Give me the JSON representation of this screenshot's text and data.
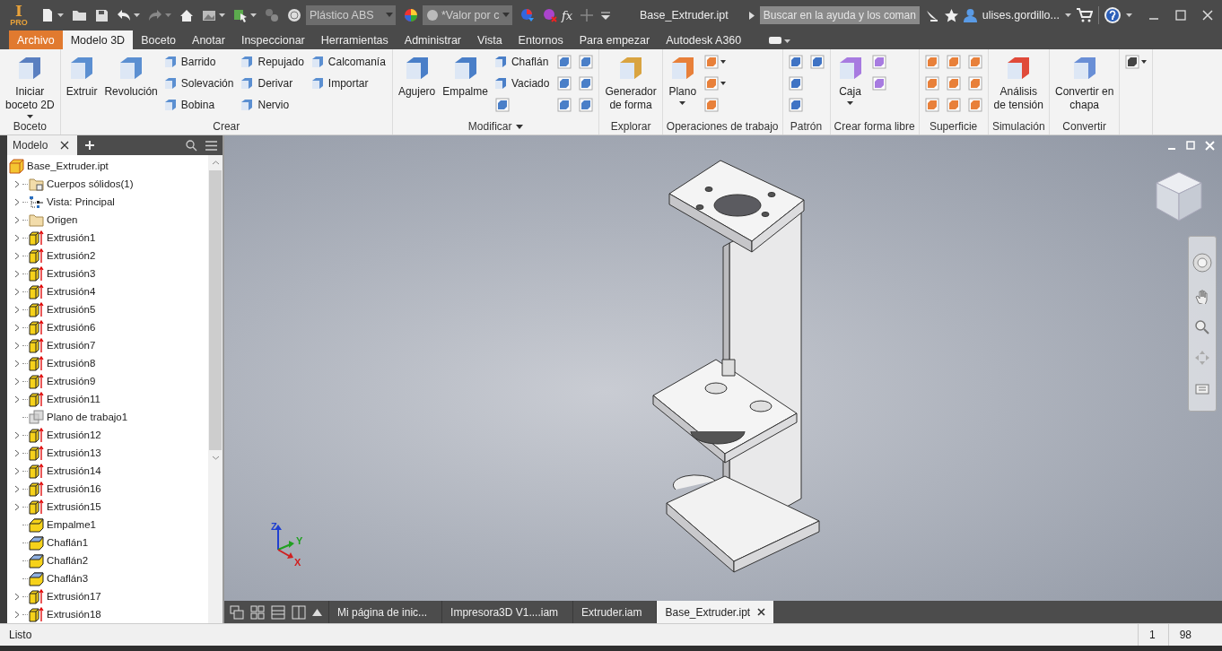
{
  "app_logo": {
    "letter": "I",
    "caption": "PRO"
  },
  "quick_access": {
    "material": "Plástico ABS",
    "appearance": "*Valor por c",
    "formula": "fx"
  },
  "window": {
    "title": "Base_Extruder.ipt"
  },
  "search": {
    "placeholder": "Buscar en la ayuda y los coman"
  },
  "user": {
    "name": "ulises.gordillo..."
  },
  "ribbon_tabs": [
    {
      "label": "Archivo",
      "kind": "app",
      "selected": false
    },
    {
      "label": "Modelo 3D",
      "kind": "tab",
      "selected": true
    },
    {
      "label": "Boceto",
      "kind": "tab",
      "selected": false
    },
    {
      "label": "Anotar",
      "kind": "tab",
      "selected": false
    },
    {
      "label": "Inspeccionar",
      "kind": "tab",
      "selected": false
    },
    {
      "label": "Herramientas",
      "kind": "tab",
      "selected": false
    },
    {
      "label": "Administrar",
      "kind": "tab",
      "selected": false
    },
    {
      "label": "Vista",
      "kind": "tab",
      "selected": false
    },
    {
      "label": "Entornos",
      "kind": "tab",
      "selected": false
    },
    {
      "label": "Para empezar",
      "kind": "tab",
      "selected": false
    },
    {
      "label": "Autodesk A360",
      "kind": "tab",
      "selected": false
    }
  ],
  "ribbon_panels": [
    {
      "title": "Boceto",
      "columns": [
        {
          "tools": [
            {
              "kind": "large",
              "label": "Iniciar\nboceto 2D",
              "dropdown": true
            }
          ]
        }
      ]
    },
    {
      "title": "Crear",
      "columns": [
        {
          "tools": [
            {
              "kind": "large",
              "label": "Extruir"
            }
          ]
        },
        {
          "tools": [
            {
              "kind": "large",
              "label": "Revolución"
            }
          ]
        },
        {
          "tools": [
            {
              "kind": "small",
              "label": "Barrido"
            },
            {
              "kind": "small",
              "label": "Solevación"
            },
            {
              "kind": "small",
              "label": "Bobina"
            }
          ]
        },
        {
          "tools": [
            {
              "kind": "small",
              "label": "Repujado"
            },
            {
              "kind": "small",
              "label": "Derivar"
            },
            {
              "kind": "small",
              "label": "Nervio"
            }
          ]
        },
        {
          "tools": [
            {
              "kind": "small",
              "label": "Calcomanía"
            },
            {
              "kind": "small",
              "label": "Importar"
            }
          ]
        }
      ]
    },
    {
      "title": "Modificar",
      "menu": true,
      "columns": [
        {
          "tools": [
            {
              "kind": "large",
              "label": "Agujero"
            }
          ]
        },
        {
          "tools": [
            {
              "kind": "large",
              "label": "Empalme"
            }
          ]
        },
        {
          "tools": [
            {
              "kind": "small",
              "label": "Chaflán"
            },
            {
              "kind": "small",
              "label": "Vaciado"
            },
            {
              "kind": "icon"
            }
          ]
        },
        {
          "tools": [
            {
              "kind": "icon"
            },
            {
              "kind": "icon"
            },
            {
              "kind": "icon"
            }
          ]
        },
        {
          "tools": [
            {
              "kind": "icon"
            },
            {
              "kind": "icon"
            },
            {
              "kind": "icon"
            }
          ]
        }
      ]
    },
    {
      "title": "Explorar",
      "columns": [
        {
          "tools": [
            {
              "kind": "large",
              "label": "Generador\nde forma"
            }
          ]
        }
      ]
    },
    {
      "title": "Operaciones de trabajo",
      "columns": [
        {
          "tools": [
            {
              "kind": "large",
              "label": "Plano",
              "dropdown": true
            }
          ]
        },
        {
          "tools": [
            {
              "kind": "icon",
              "dropdown": true
            },
            {
              "kind": "icon",
              "dropdown": true
            },
            {
              "kind": "icon"
            }
          ]
        }
      ]
    },
    {
      "title": "Patrón",
      "columns": [
        {
          "tools": [
            {
              "kind": "icon"
            },
            {
              "kind": "icon"
            },
            {
              "kind": "icon"
            }
          ]
        },
        {
          "tools": [
            {
              "kind": "icon"
            }
          ]
        }
      ]
    },
    {
      "title": "Crear forma libre",
      "columns": [
        {
          "tools": [
            {
              "kind": "large",
              "label": "Caja",
              "dropdown": true
            }
          ]
        },
        {
          "tools": [
            {
              "kind": "icon"
            },
            {
              "kind": "icon"
            }
          ]
        }
      ]
    },
    {
      "title": "Superficie",
      "columns": [
        {
          "tools": [
            {
              "kind": "icon"
            },
            {
              "kind": "icon"
            },
            {
              "kind": "icon"
            }
          ]
        },
        {
          "tools": [
            {
              "kind": "icon"
            },
            {
              "kind": "icon"
            },
            {
              "kind": "icon"
            }
          ]
        },
        {
          "tools": [
            {
              "kind": "icon"
            },
            {
              "kind": "icon"
            },
            {
              "kind": "icon"
            }
          ]
        }
      ]
    },
    {
      "title": "Simulación",
      "columns": [
        {
          "tools": [
            {
              "kind": "large",
              "label": "Análisis\nde tensión"
            }
          ]
        }
      ]
    },
    {
      "title": "Convertir",
      "columns": [
        {
          "tools": [
            {
              "kind": "large",
              "label": "Convertir en\nchapa"
            }
          ]
        }
      ]
    },
    {
      "columns": [
        {
          "tools": [
            {
              "kind": "icon",
              "dropdown": true
            }
          ]
        }
      ]
    }
  ],
  "browser": {
    "tab": "Modelo",
    "root": {
      "label": "Base_Extruder.ipt",
      "children": [
        {
          "label": "Cuerpos sólidos(1)",
          "kind": "solids",
          "collapsible": true
        },
        {
          "label": "Vista: Principal",
          "kind": "view",
          "collapsible": true
        },
        {
          "label": "Origen",
          "kind": "folder",
          "collapsible": true
        },
        {
          "label": "Extrusión1",
          "kind": "extrusion",
          "collapsible": true
        },
        {
          "label": "Extrusión2",
          "kind": "extrusion",
          "collapsible": true
        },
        {
          "label": "Extrusión3",
          "kind": "extrusion",
          "collapsible": true
        },
        {
          "label": "Extrusión4",
          "kind": "extrusion",
          "collapsible": true
        },
        {
          "label": "Extrusión5",
          "kind": "extrusion",
          "collapsible": true
        },
        {
          "label": "Extrusión6",
          "kind": "extrusion",
          "collapsible": true
        },
        {
          "label": "Extrusión7",
          "kind": "extrusion",
          "collapsible": true
        },
        {
          "label": "Extrusión8",
          "kind": "extrusion",
          "collapsible": true
        },
        {
          "label": "Extrusión9",
          "kind": "extrusion",
          "collapsible": true
        },
        {
          "label": "Extrusión11",
          "kind": "extrusion",
          "collapsible": true
        },
        {
          "label": "Plano de trabajo1",
          "kind": "plane",
          "collapsible": false
        },
        {
          "label": "Extrusión12",
          "kind": "extrusion",
          "collapsible": true
        },
        {
          "label": "Extrusión13",
          "kind": "extrusion",
          "collapsible": true
        },
        {
          "label": "Extrusión14",
          "kind": "extrusion",
          "collapsible": true
        },
        {
          "label": "Extrusión16",
          "kind": "extrusion",
          "collapsible": true
        },
        {
          "label": "Extrusión15",
          "kind": "extrusion",
          "collapsible": true
        },
        {
          "label": "Empalme1",
          "kind": "fillet",
          "collapsible": false
        },
        {
          "label": "Chaflán1",
          "kind": "chamfer",
          "collapsible": false
        },
        {
          "label": "Chaflán2",
          "kind": "chamfer",
          "collapsible": false
        },
        {
          "label": "Chaflán3",
          "kind": "chamfer",
          "collapsible": false
        },
        {
          "label": "Extrusión17",
          "kind": "extrusion",
          "collapsible": true
        },
        {
          "label": "Extrusión18",
          "kind": "extrusion",
          "collapsible": true
        }
      ]
    }
  },
  "viewport": {
    "axes": [
      {
        "label": "Z",
        "color": "#2040d0"
      },
      {
        "label": "Y",
        "color": "#20a020"
      },
      {
        "label": "X",
        "color": "#d02020"
      }
    ]
  },
  "document_tabs": [
    {
      "label": "Mi página de inic...",
      "selected": false
    },
    {
      "label": "Impresora3D V1....iam",
      "selected": false
    },
    {
      "label": "Extruder.iam",
      "selected": false
    },
    {
      "label": "Base_Extruder.ipt",
      "selected": true
    }
  ],
  "status_bar": {
    "message": "Listo",
    "fields": [
      "1",
      "98"
    ]
  }
}
